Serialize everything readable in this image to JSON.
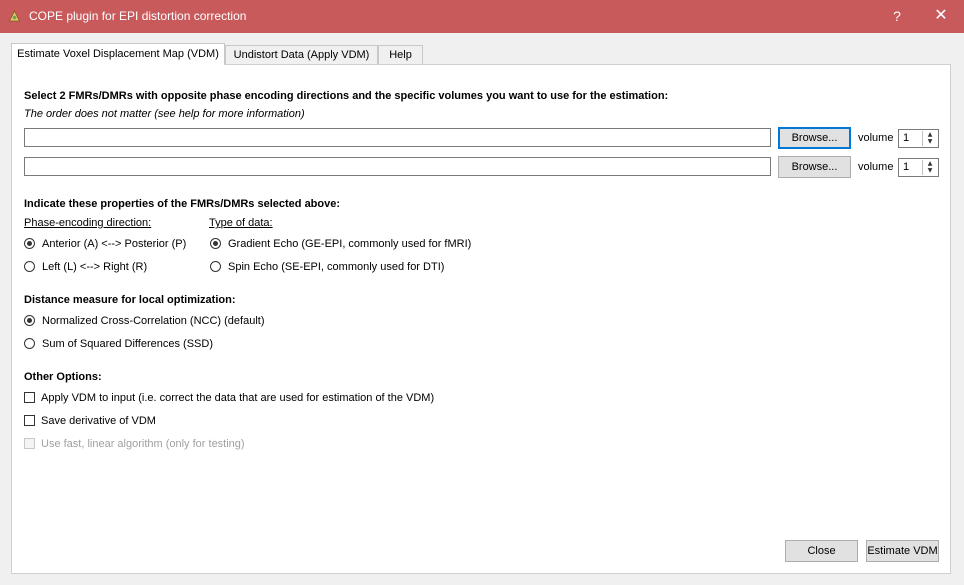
{
  "window": {
    "title": "COPE plugin for EPI distortion correction",
    "help_button": "?",
    "close_button": "✕"
  },
  "tabs": [
    {
      "label": "Estimate Voxel Displacement Map (VDM)",
      "active": true
    },
    {
      "label": "Undistort Data (Apply VDM)",
      "active": false
    },
    {
      "label": "Help",
      "active": false
    }
  ],
  "select": {
    "heading": "Select 2 FMRs/DMRs with opposite phase encoding directions and the specific volumes you want to use for the estimation:",
    "note": "The order does not matter (see help for more information)",
    "rows": [
      {
        "path": "",
        "browse_label": "Browse...",
        "volume_label": "volume",
        "volume_value": "1"
      },
      {
        "path": "",
        "browse_label": "Browse...",
        "volume_label": "volume",
        "volume_value": "1"
      }
    ]
  },
  "properties": {
    "heading": "Indicate these properties of the FMRs/DMRs selected above:",
    "phase_label": "Phase-encoding direction:",
    "phase_options": [
      {
        "label": "Anterior (A) <--> Posterior (P)",
        "checked": true
      },
      {
        "label": "Left (L) <--> Right (R)",
        "checked": false
      }
    ],
    "type_label": "Type of data:",
    "type_options": [
      {
        "label": "Gradient Echo (GE-EPI, commonly used for fMRI)",
        "checked": true
      },
      {
        "label": "Spin Echo (SE-EPI, commonly used for DTI)",
        "checked": false
      }
    ]
  },
  "distance": {
    "heading": "Distance measure for local optimization:",
    "options": [
      {
        "label": "Normalized Cross-Correlation (NCC) (default)",
        "checked": true
      },
      {
        "label": "Sum of Squared Differences (SSD)",
        "checked": false
      }
    ]
  },
  "other": {
    "heading": "Other Options:",
    "options": [
      {
        "label": "Apply VDM to input (i.e. correct the data that are used for estimation of the VDM)",
        "checked": false,
        "enabled": true
      },
      {
        "label": "Save derivative of VDM",
        "checked": false,
        "enabled": true
      },
      {
        "label": "Use fast, linear algorithm (only for testing)",
        "checked": false,
        "enabled": false
      }
    ]
  },
  "footer": {
    "close_label": "Close",
    "estimate_label": "Estimate VDM"
  },
  "colors": {
    "titlebar": "#c85a5c",
    "focus_border": "#0078d7"
  }
}
